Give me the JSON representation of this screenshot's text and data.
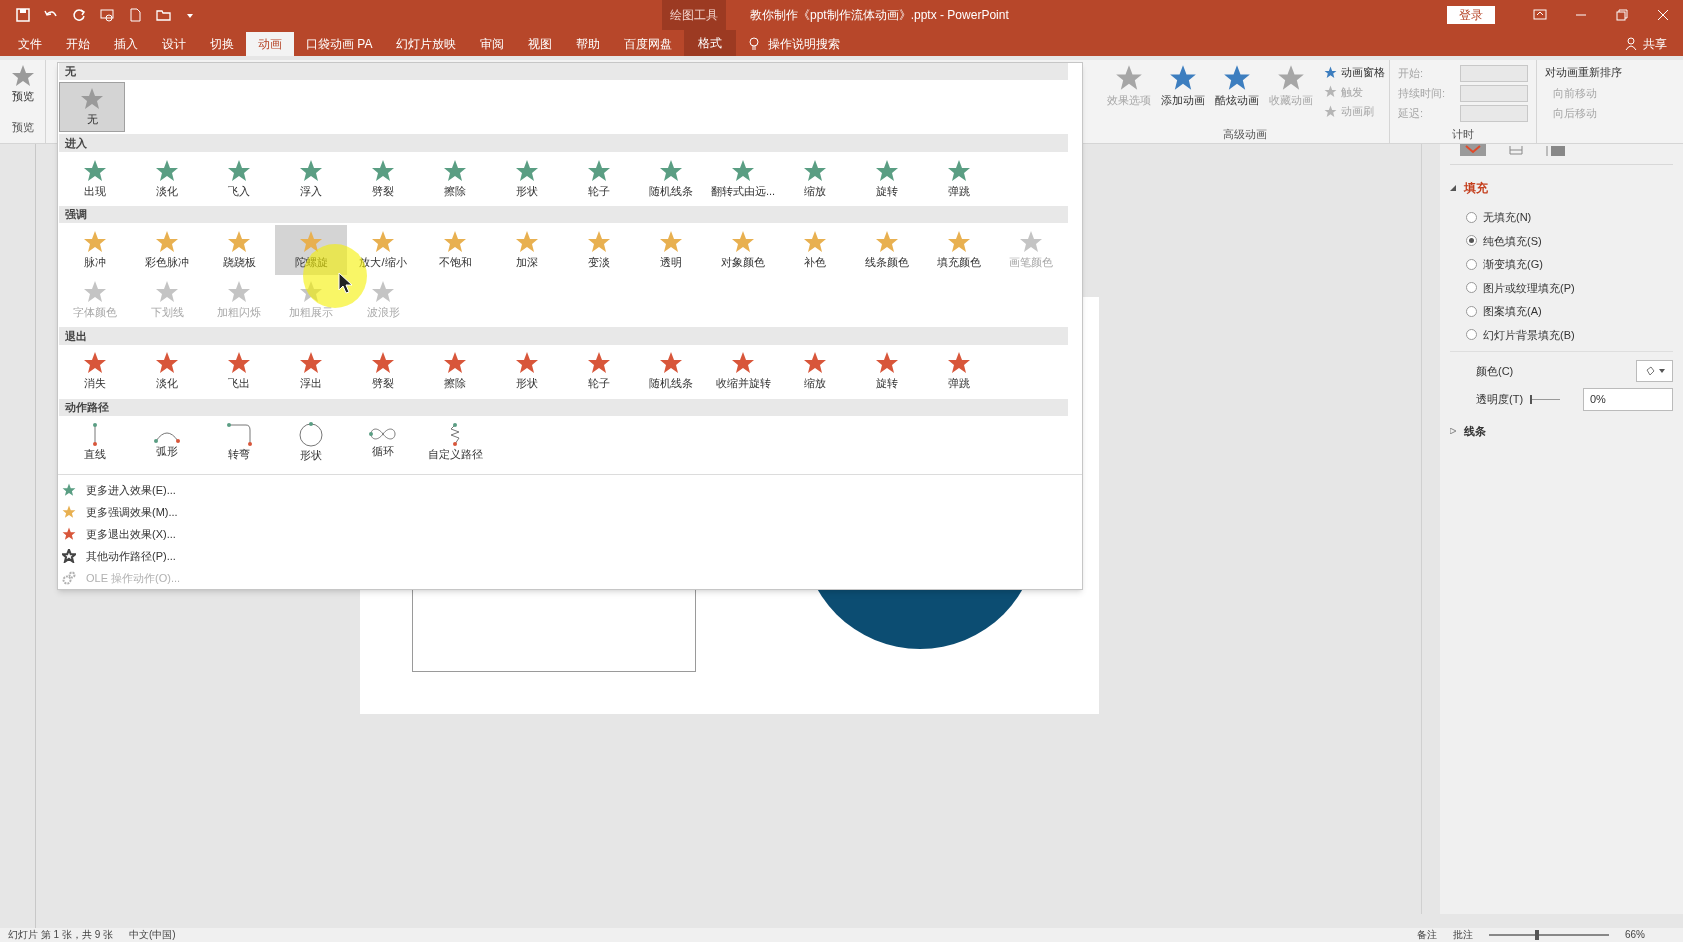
{
  "title_bar": {
    "context_label": "绘图工具",
    "title": "教你制作《ppt制作流体动画》.pptx  -  PowerPoint",
    "login": "登录"
  },
  "tabs": [
    {
      "label": "文件",
      "selected": false,
      "kind": "normal"
    },
    {
      "label": "开始",
      "selected": false,
      "kind": "normal"
    },
    {
      "label": "插入",
      "selected": false,
      "kind": "normal"
    },
    {
      "label": "设计",
      "selected": false,
      "kind": "normal"
    },
    {
      "label": "切换",
      "selected": false,
      "kind": "normal"
    },
    {
      "label": "动画",
      "selected": true,
      "kind": "normal"
    },
    {
      "label": "口袋动画 PA",
      "selected": false,
      "kind": "normal"
    },
    {
      "label": "幻灯片放映",
      "selected": false,
      "kind": "normal"
    },
    {
      "label": "审阅",
      "selected": false,
      "kind": "normal"
    },
    {
      "label": "视图",
      "selected": false,
      "kind": "normal"
    },
    {
      "label": "帮助",
      "selected": false,
      "kind": "normal"
    },
    {
      "label": "百度网盘",
      "selected": false,
      "kind": "normal"
    },
    {
      "label": "格式",
      "selected": false,
      "kind": "context"
    }
  ],
  "search": {
    "label": "操作说明搜索"
  },
  "share": "共享",
  "ribbon": {
    "preview": {
      "label": "预览",
      "group": "预览"
    },
    "big_buttons": [
      {
        "label": "效果选项",
        "disabled": true,
        "color": "#a6a6a6"
      },
      {
        "label": "添加动画",
        "disabled": false,
        "color": "#3d7ebf"
      },
      {
        "label": "酷炫动画",
        "disabled": false,
        "color": "#3d7ebf"
      },
      {
        "label": "收藏动画",
        "disabled": true,
        "color": "#a6a6a6"
      }
    ],
    "small_buttons": [
      {
        "label": "动画窗格",
        "disabled": false
      },
      {
        "label": "触发",
        "disabled": true
      },
      {
        "label": "动画刷",
        "disabled": true
      }
    ],
    "advanced_group": "高级动画",
    "timing": [
      {
        "label": "开始:",
        "disabled": true
      },
      {
        "label": "持续时间:",
        "disabled": true
      },
      {
        "label": "延迟:",
        "disabled": true
      }
    ],
    "timing_group": "计时",
    "reorder": {
      "title": "对动画重新排序",
      "items": [
        {
          "label": "向前移动",
          "disabled": true
        },
        {
          "label": "向后移动",
          "disabled": true
        }
      ]
    }
  },
  "gallery": {
    "sections": [
      {
        "title": "无",
        "kind": "none",
        "color": "#9a9a9a",
        "items": [
          {
            "label": "无",
            "selected": true,
            "disabled": false
          }
        ]
      },
      {
        "title": "进入",
        "kind": "star",
        "color": "#5a9e83",
        "items": [
          {
            "label": "出现",
            "selected": false,
            "disabled": false
          },
          {
            "label": "淡化",
            "selected": false,
            "disabled": false
          },
          {
            "label": "飞入",
            "selected": false,
            "disabled": false
          },
          {
            "label": "浮入",
            "selected": false,
            "disabled": false
          },
          {
            "label": "劈裂",
            "selected": false,
            "disabled": false
          },
          {
            "label": "擦除",
            "selected": false,
            "disabled": false
          },
          {
            "label": "形状",
            "selected": false,
            "disabled": false
          },
          {
            "label": "轮子",
            "selected": false,
            "disabled": false
          },
          {
            "label": "随机线条",
            "selected": false,
            "disabled": false
          },
          {
            "label": "翻转式由远...",
            "selected": false,
            "disabled": false
          },
          {
            "label": "缩放",
            "selected": false,
            "disabled": false
          },
          {
            "label": "旋转",
            "selected": false,
            "disabled": false
          },
          {
            "label": "弹跳",
            "selected": false,
            "disabled": false
          }
        ]
      },
      {
        "title": "强调",
        "kind": "star",
        "color": "#e8b050",
        "items": [
          {
            "label": "脉冲",
            "selected": false,
            "disabled": false
          },
          {
            "label": "彩色脉冲",
            "selected": false,
            "disabled": false
          },
          {
            "label": "跷跷板",
            "selected": false,
            "disabled": false
          },
          {
            "label": "陀螺旋",
            "selected": true,
            "disabled": false
          },
          {
            "label": "放大/缩小",
            "selected": false,
            "disabled": false
          },
          {
            "label": "不饱和",
            "selected": false,
            "disabled": false
          },
          {
            "label": "加深",
            "selected": false,
            "disabled": false
          },
          {
            "label": "变淡",
            "selected": false,
            "disabled": false
          },
          {
            "label": "透明",
            "selected": false,
            "disabled": false
          },
          {
            "label": "对象颜色",
            "selected": false,
            "disabled": false
          },
          {
            "label": "补色",
            "selected": false,
            "disabled": false
          },
          {
            "label": "线条颜色",
            "selected": false,
            "disabled": false
          },
          {
            "label": "填充颜色",
            "selected": false,
            "disabled": false
          },
          {
            "label": "画笔颜色",
            "selected": false,
            "disabled": true
          },
          {
            "label": "字体颜色",
            "selected": false,
            "disabled": true
          },
          {
            "label": "下划线",
            "selected": false,
            "disabled": true
          },
          {
            "label": "加粗闪烁",
            "selected": false,
            "disabled": true
          },
          {
            "label": "加粗展示",
            "selected": false,
            "disabled": true
          },
          {
            "label": "波浪形",
            "selected": false,
            "disabled": true
          }
        ]
      },
      {
        "title": "退出",
        "kind": "star",
        "color": "#d8563a",
        "items": [
          {
            "label": "消失",
            "selected": false,
            "disabled": false
          },
          {
            "label": "淡化",
            "selected": false,
            "disabled": false
          },
          {
            "label": "飞出",
            "selected": false,
            "disabled": false
          },
          {
            "label": "浮出",
            "selected": false,
            "disabled": false
          },
          {
            "label": "劈裂",
            "selected": false,
            "disabled": false
          },
          {
            "label": "擦除",
            "selected": false,
            "disabled": false
          },
          {
            "label": "形状",
            "selected": false,
            "disabled": false
          },
          {
            "label": "轮子",
            "selected": false,
            "disabled": false
          },
          {
            "label": "随机线条",
            "selected": false,
            "disabled": false
          },
          {
            "label": "收缩并旋转",
            "selected": false,
            "disabled": false
          },
          {
            "label": "缩放",
            "selected": false,
            "disabled": false
          },
          {
            "label": "旋转",
            "selected": false,
            "disabled": false
          },
          {
            "label": "弹跳",
            "selected": false,
            "disabled": false
          }
        ]
      },
      {
        "title": "动作路径",
        "kind": "path",
        "items": [
          {
            "label": "直线",
            "selected": false,
            "disabled": false,
            "kind": "line"
          },
          {
            "label": "弧形",
            "selected": false,
            "disabled": false,
            "kind": "arc"
          },
          {
            "label": "转弯",
            "selected": false,
            "disabled": false,
            "kind": "turn"
          },
          {
            "label": "形状",
            "selected": false,
            "disabled": false,
            "kind": "circle"
          },
          {
            "label": "循环",
            "selected": false,
            "disabled": false,
            "kind": "loop"
          },
          {
            "label": "自定义路径",
            "selected": false,
            "disabled": false,
            "kind": "custom"
          }
        ]
      }
    ],
    "more": [
      {
        "label": "更多进入效果(E)...",
        "color": "#5a9e83",
        "disabled": false,
        "kind": "star"
      },
      {
        "label": "更多强调效果(M)...",
        "color": "#e8b050",
        "disabled": false,
        "kind": "star"
      },
      {
        "label": "更多退出效果(X)...",
        "color": "#d8563a",
        "disabled": false,
        "kind": "star"
      },
      {
        "label": "其他动作路径(P)...",
        "color": "#444444",
        "disabled": false,
        "kind": "outline"
      },
      {
        "label": "OLE 操作动作(O)...",
        "color": "#b0b0b0",
        "disabled": true,
        "kind": "gears"
      }
    ]
  },
  "format_pane": {
    "fill_title": "填充",
    "fill_expanded": true,
    "options": [
      {
        "label": "无填充(N)",
        "selected": false
      },
      {
        "label": "纯色填充(S)",
        "selected": true
      },
      {
        "label": "渐变填充(G)",
        "selected": false
      },
      {
        "label": "图片或纹理填充(P)",
        "selected": false
      },
      {
        "label": "图案填充(A)",
        "selected": false
      },
      {
        "label": "幻灯片背景填充(B)",
        "selected": false
      }
    ],
    "color_label": "颜色(C)",
    "transparency_label": "透明度(T)",
    "transparency": {
      "level": 0,
      "value": "0%"
    },
    "line_title": "线条",
    "line_expanded": false
  },
  "status_bar": {
    "slide": "幻灯片 第 1 张，共 9 张",
    "language": "中文(中国)",
    "notes": "备注",
    "comments": "批注",
    "zoom": "66%",
    "zoom_slider": {
      "level": 0.4
    }
  }
}
